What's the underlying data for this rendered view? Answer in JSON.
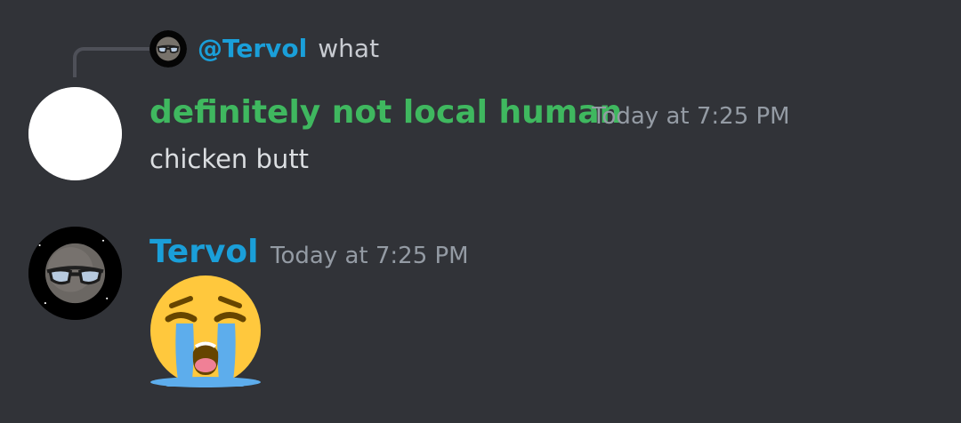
{
  "reply_preview": {
    "author_avatar_icon": "planet-face-avatar-icon",
    "username": "@Tervol",
    "text": "what"
  },
  "messages": [
    {
      "author": {
        "name": "definitely not local human",
        "name_color": "#3fb85f",
        "avatar_icon": "blank-white-avatar-icon"
      },
      "timestamp": "Today at 7:25 PM",
      "content": "chicken butt"
    },
    {
      "author": {
        "name": "Tervol",
        "name_color": "#1a9fd9",
        "avatar_icon": "planet-face-avatar-icon"
      },
      "timestamp": "Today at 7:25 PM",
      "content_emoji": "loudly-crying-face-emoji"
    }
  ],
  "colors": {
    "background": "#313338",
    "mention": "#1a9fd9",
    "timestamp": "#949ba4",
    "text": "#dbdee1"
  }
}
